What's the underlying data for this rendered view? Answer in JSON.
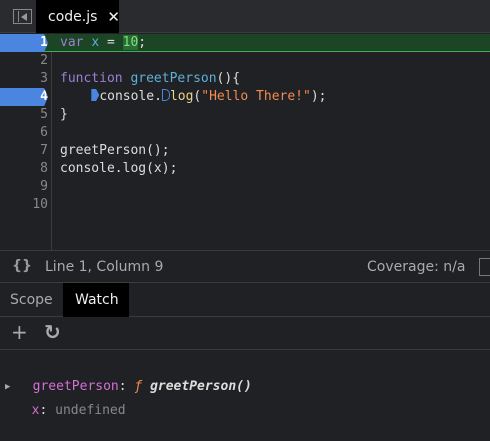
{
  "tab": {
    "filename": "code.js",
    "close": "✕"
  },
  "code_lines": [
    {
      "n": "1"
    },
    {
      "n": "2"
    },
    {
      "n": "3"
    },
    {
      "n": "4"
    },
    {
      "n": "5"
    },
    {
      "n": "6"
    },
    {
      "n": "7"
    },
    {
      "n": "8"
    },
    {
      "n": "9"
    },
    {
      "n": "10"
    }
  ],
  "code": {
    "l1": {
      "kw": "var",
      "id": "x",
      "op": " = ",
      "num": "10",
      "end": ";"
    },
    "l3": {
      "kw": "function",
      "fn": "greetPerson",
      "end": "(){"
    },
    "l4": {
      "a": "console.",
      "b": "log",
      "c": "(",
      "str": "\"Hello There!\"",
      "d": ");"
    },
    "l5": "}",
    "l7": "greetPerson();",
    "l8": "console.log(x);"
  },
  "status": {
    "braces": "{}",
    "position": "Line 1, Column 9",
    "coverage": "Coverage: n/a"
  },
  "panel_tabs": {
    "scope": "Scope",
    "watch": "Watch"
  },
  "toolbar": {
    "add": "+",
    "refresh": "↻"
  },
  "watch": [
    {
      "name": "greetPerson",
      "sep": ": ",
      "fsym": "ƒ ",
      "value": "greetPerson()"
    },
    {
      "name": "x",
      "sep": ": ",
      "value": "undefined"
    }
  ],
  "breakpoint_lines": [
    1,
    4
  ],
  "current_line": 1
}
